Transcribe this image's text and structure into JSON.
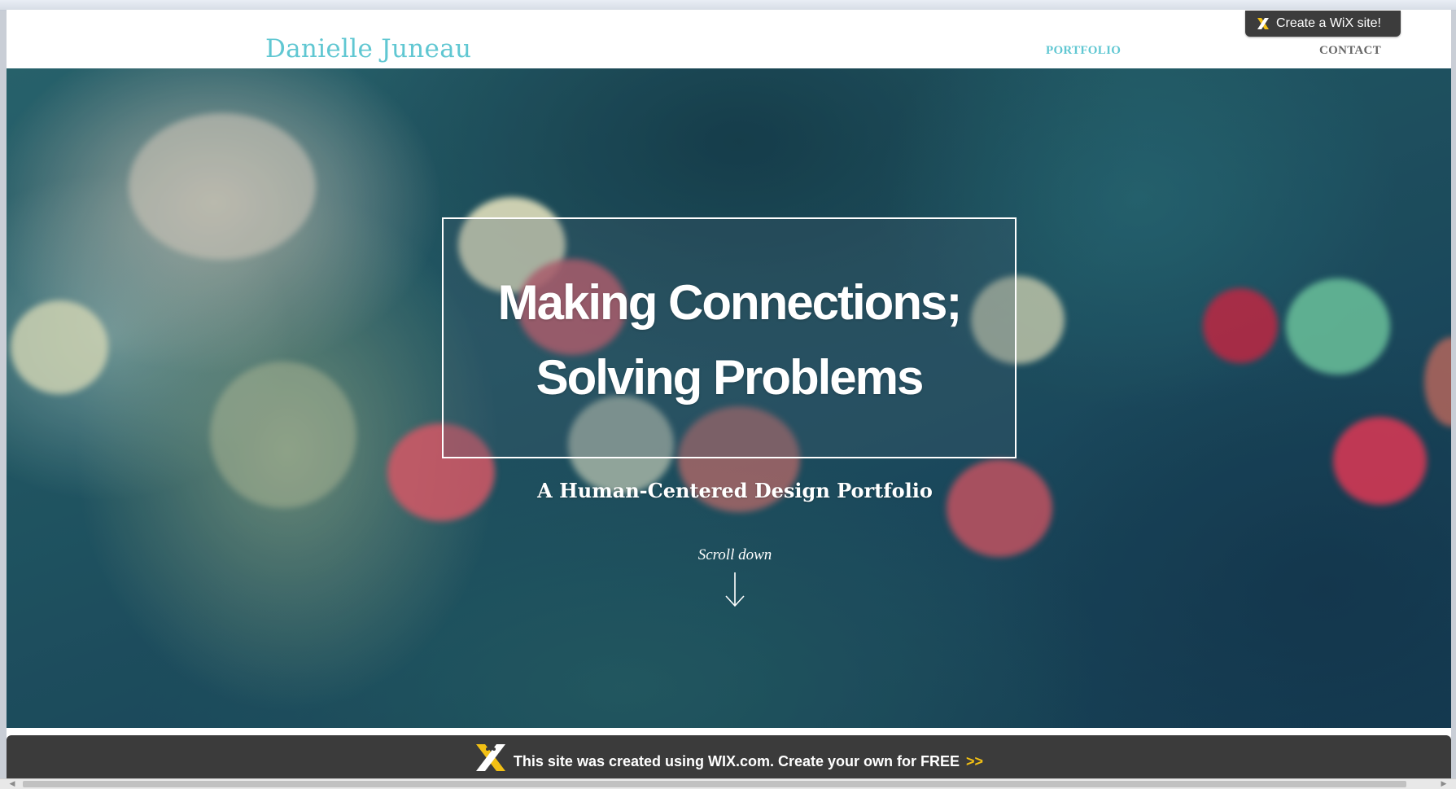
{
  "header": {
    "brand": "Danielle Juneau",
    "nav": [
      {
        "label": "PORTFOLIO",
        "active": true
      },
      {
        "label": "CONTACT",
        "active": false
      }
    ]
  },
  "wix_badge": {
    "label": "Create a WiX site!",
    "icon": "wix-x-icon"
  },
  "hero": {
    "headline_line1": "Making Connections;",
    "headline_line2": "Solving Problems",
    "tagline": "A Human-Centered Design Portfolio",
    "scroll_label": "Scroll down",
    "scroll_icon": "arrow-down-icon"
  },
  "footer_bar": {
    "text": "This site was created using WIX.com. Create your own for FREE",
    "cta": ">>",
    "icon": "wix-x-icon"
  },
  "colors": {
    "brand": "#60c7d2",
    "nav_active": "#60c7d2",
    "nav_inactive": "#666666",
    "badge_bg": "#3c3c3c",
    "footer_bg": "#3b3b3b",
    "cta": "#f2c014",
    "x_icon": "#f2c014"
  }
}
